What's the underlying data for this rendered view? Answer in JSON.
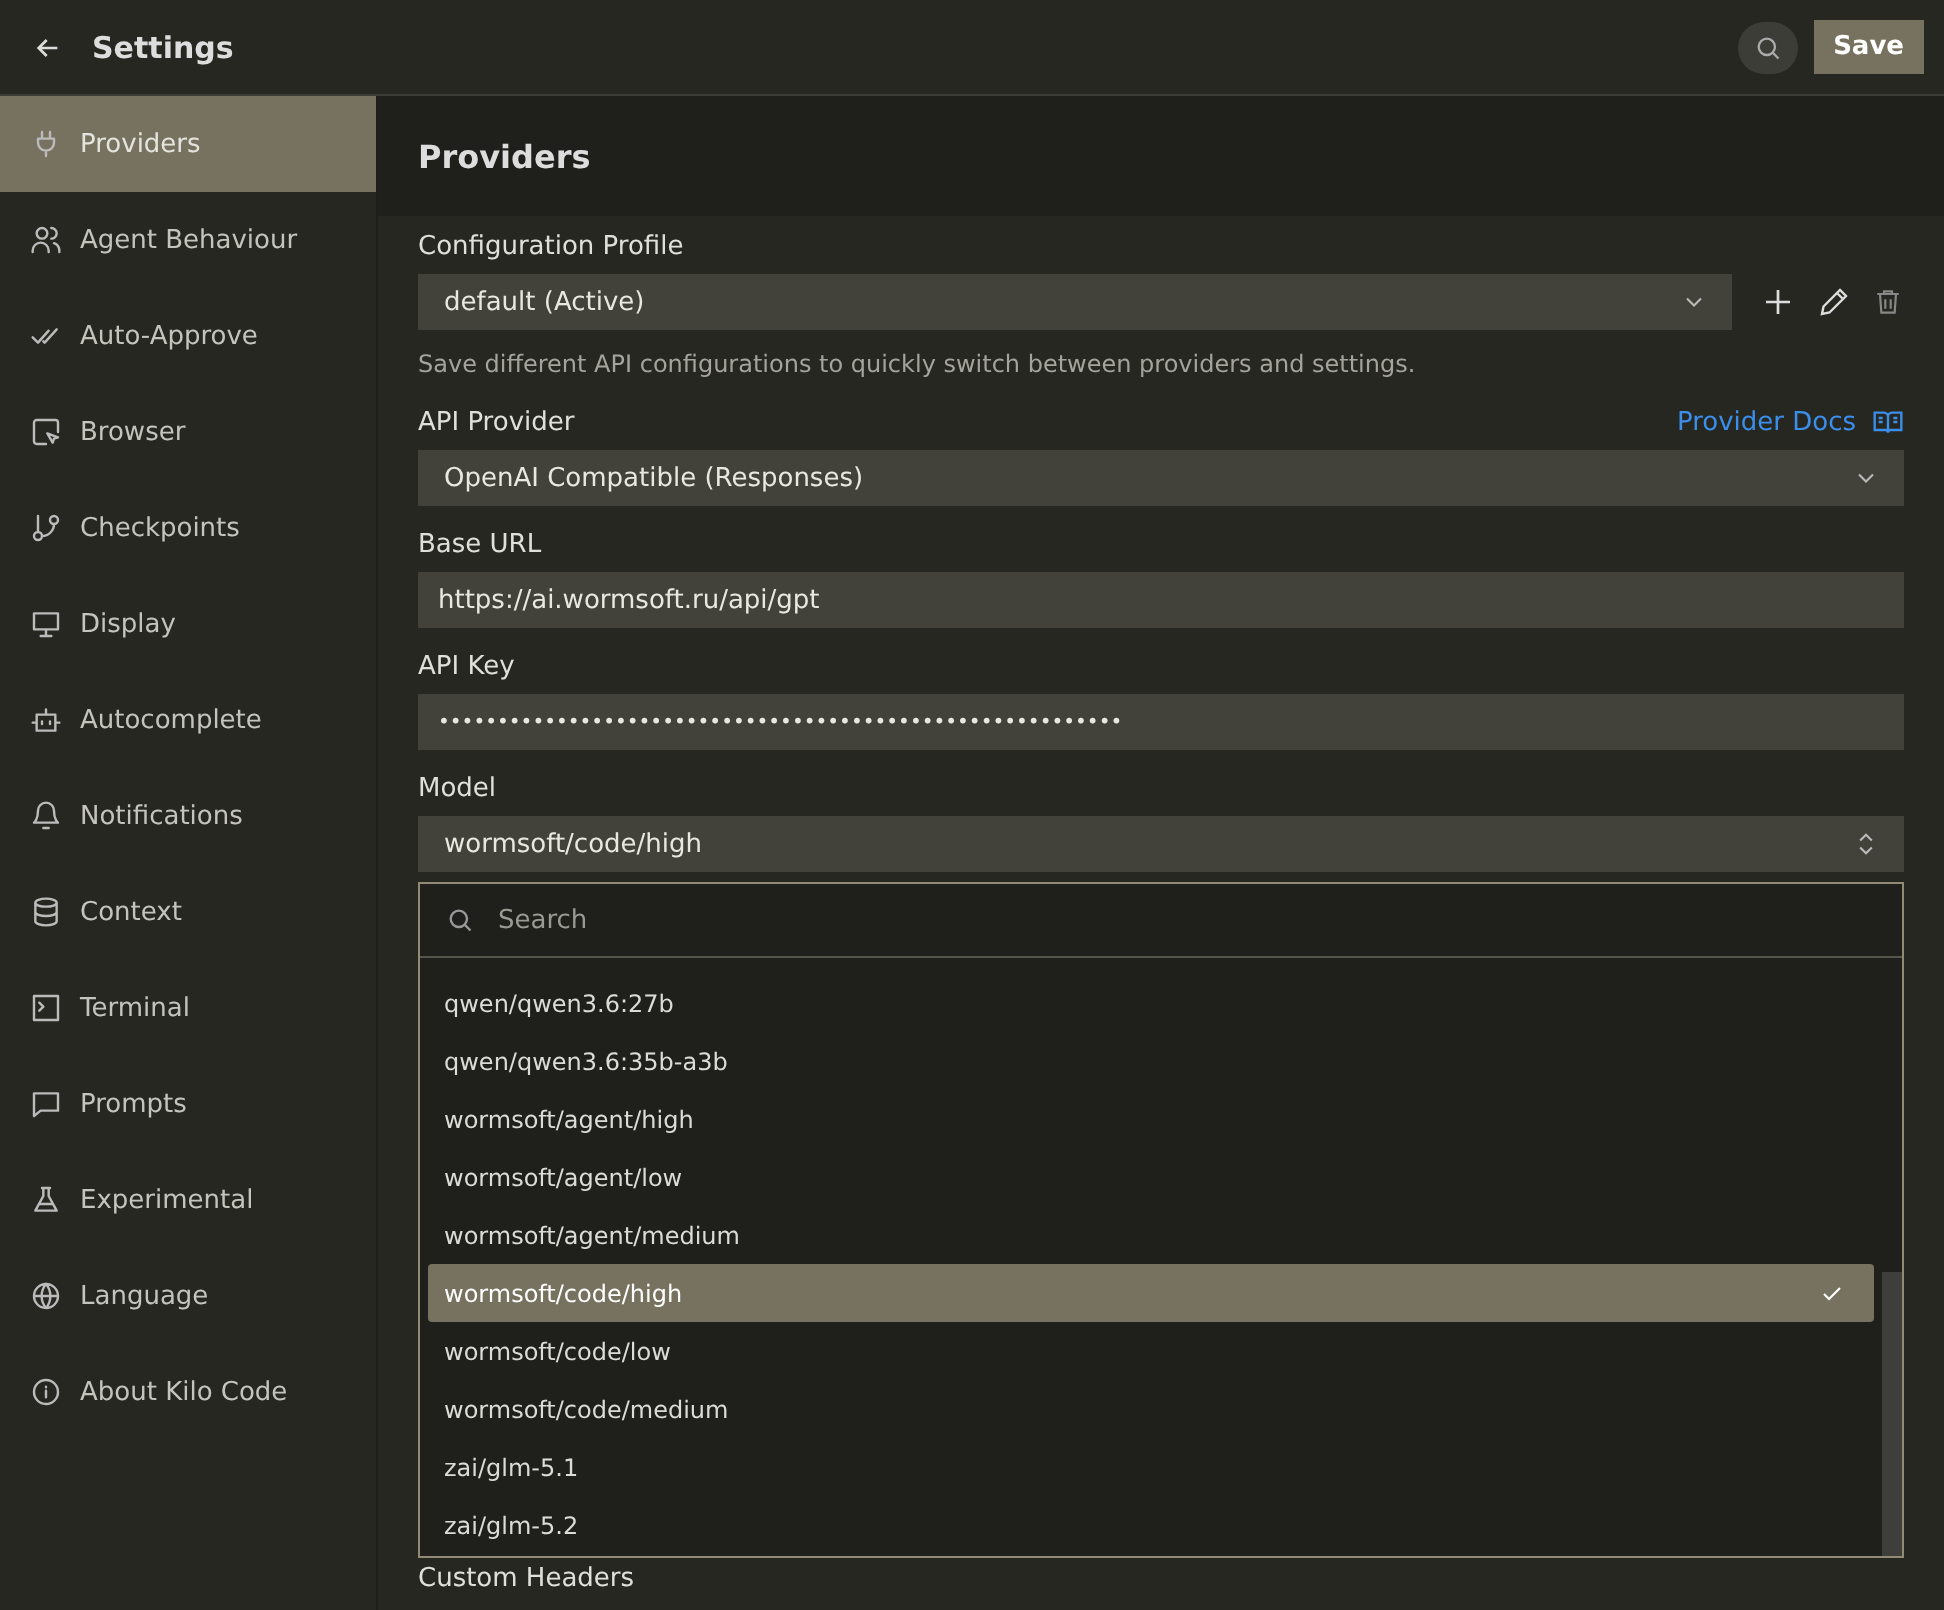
{
  "header": {
    "title": "Settings",
    "save_label": "Save"
  },
  "sidebar": {
    "items": [
      {
        "label": "Providers",
        "selected": true
      },
      {
        "label": "Agent Behaviour",
        "selected": false
      },
      {
        "label": "Auto-Approve",
        "selected": false
      },
      {
        "label": "Browser",
        "selected": false
      },
      {
        "label": "Checkpoints",
        "selected": false
      },
      {
        "label": "Display",
        "selected": false
      },
      {
        "label": "Autocomplete",
        "selected": false
      },
      {
        "label": "Notifications",
        "selected": false
      },
      {
        "label": "Context",
        "selected": false
      },
      {
        "label": "Terminal",
        "selected": false
      },
      {
        "label": "Prompts",
        "selected": false
      },
      {
        "label": "Experimental",
        "selected": false
      },
      {
        "label": "Language",
        "selected": false
      },
      {
        "label": "About Kilo Code",
        "selected": false
      }
    ]
  },
  "section_title": "Providers",
  "config_profile": {
    "label": "Configuration Profile",
    "value": "default (Active)",
    "help": "Save different API configurations to quickly switch between providers and settings."
  },
  "api_provider": {
    "label": "API Provider",
    "docs_link": "Provider Docs",
    "value": "OpenAI Compatible (Responses)"
  },
  "base_url": {
    "label": "Base URL",
    "value": "https://ai.wormsoft.ru/api/gpt"
  },
  "api_key": {
    "label": "API Key",
    "value": "••••••••••••••••••••••••••••••••••••••••••••••••••••••••••"
  },
  "model": {
    "label": "Model",
    "value": "wormsoft/code/high",
    "dropdown": {
      "placeholder": "Search",
      "options": [
        {
          "label": "qwen/qwen3.6:27b",
          "selected": false
        },
        {
          "label": "qwen/qwen3.6:35b-a3b",
          "selected": false
        },
        {
          "label": "wormsoft/agent/high",
          "selected": false
        },
        {
          "label": "wormsoft/agent/low",
          "selected": false
        },
        {
          "label": "wormsoft/agent/medium",
          "selected": false
        },
        {
          "label": "wormsoft/code/high",
          "selected": true
        },
        {
          "label": "wormsoft/code/low",
          "selected": false
        },
        {
          "label": "wormsoft/code/medium",
          "selected": false
        },
        {
          "label": "zai/glm-5.1",
          "selected": false
        },
        {
          "label": "zai/glm-5.2",
          "selected": false
        }
      ]
    }
  },
  "custom_headers": {
    "label": "Custom Headers"
  }
}
